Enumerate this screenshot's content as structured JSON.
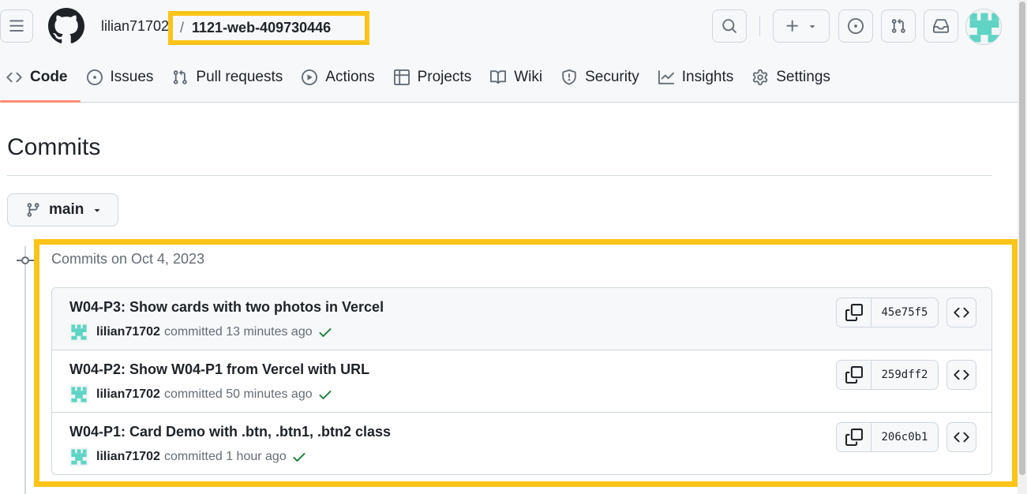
{
  "header": {
    "owner": "lilian71702",
    "separator": "/",
    "repo": "1121-web-409730446",
    "icons": [
      "hamburger-icon",
      "github-logo",
      "search-icon",
      "plus-icon",
      "triangle-down-icon",
      "issue-icon",
      "pull-request-icon",
      "inbox-icon",
      "avatar"
    ]
  },
  "tabs": [
    {
      "label": "Code",
      "icon": "code-icon",
      "selected": true
    },
    {
      "label": "Issues",
      "icon": "issue-icon"
    },
    {
      "label": "Pull requests",
      "icon": "pull-request-icon"
    },
    {
      "label": "Actions",
      "icon": "play-icon"
    },
    {
      "label": "Projects",
      "icon": "table-icon"
    },
    {
      "label": "Wiki",
      "icon": "book-icon"
    },
    {
      "label": "Security",
      "icon": "shield-icon"
    },
    {
      "label": "Insights",
      "icon": "graph-icon"
    },
    {
      "label": "Settings",
      "icon": "gear-icon"
    }
  ],
  "page": {
    "title": "Commits",
    "branch": "main",
    "group_header": "Commits on Oct 4, 2023"
  },
  "commits": [
    {
      "title": "W04-P3: Show cards with two photos in Vercel",
      "author": "lilian71702",
      "action": "committed",
      "time": "13 minutes ago",
      "sha": "45e75f5"
    },
    {
      "title": "W04-P2: Show W04-P1 from Vercel with URL",
      "author": "lilian71702",
      "action": "committed",
      "time": "50 minutes ago",
      "sha": "259dff2"
    },
    {
      "title": "W04-P1: Card Demo with .btn, .btn1, .btn2 class",
      "author": "lilian71702",
      "action": "committed",
      "time": "1 hour ago",
      "sha": "206c0b1"
    }
  ],
  "colors": {
    "highlight": "#fcc418",
    "selected_tab_underline": "#fd8c73",
    "success_check": "#1a7f37",
    "avatar_teal": "#5fd4c4"
  }
}
